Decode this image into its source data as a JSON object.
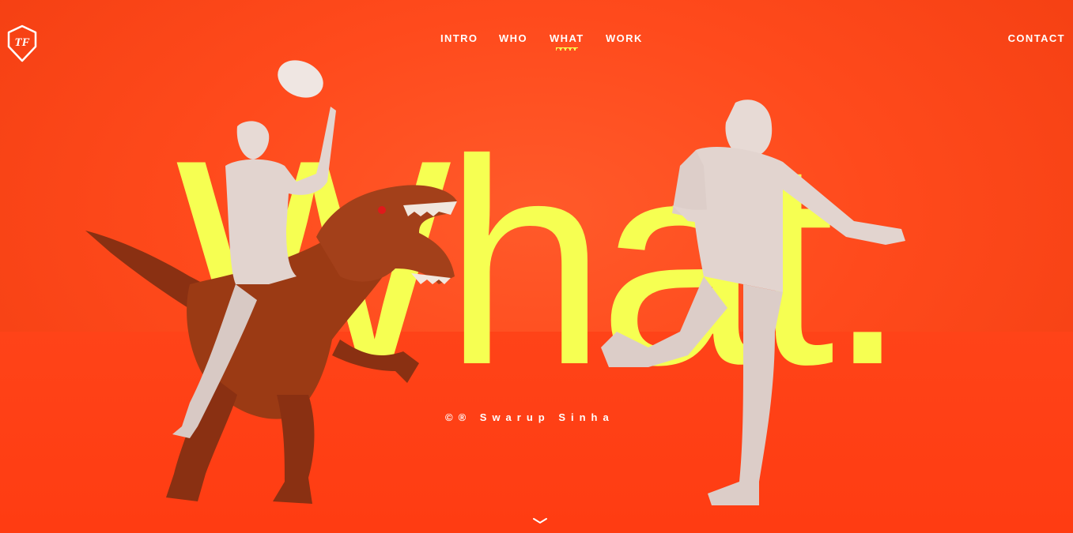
{
  "brand": {
    "logo_text": "TF",
    "logo_icon": "tf-shield-logo"
  },
  "nav": {
    "items": [
      {
        "label": "INTRO",
        "active": false
      },
      {
        "label": "WHO",
        "active": false
      },
      {
        "label": "WHAT",
        "active": true
      },
      {
        "label": "WORK",
        "active": false
      }
    ],
    "contact_label": "CONTACT"
  },
  "hero": {
    "headline": "What.",
    "credit": "©® Swarup Sinha"
  },
  "colors": {
    "background": "#ff4a1c",
    "headline": "#f6ff52",
    "nav_text": "#ffffff",
    "active_underline": "#f6ff52"
  },
  "icons": {
    "scroll": "chevron-down-icon"
  }
}
